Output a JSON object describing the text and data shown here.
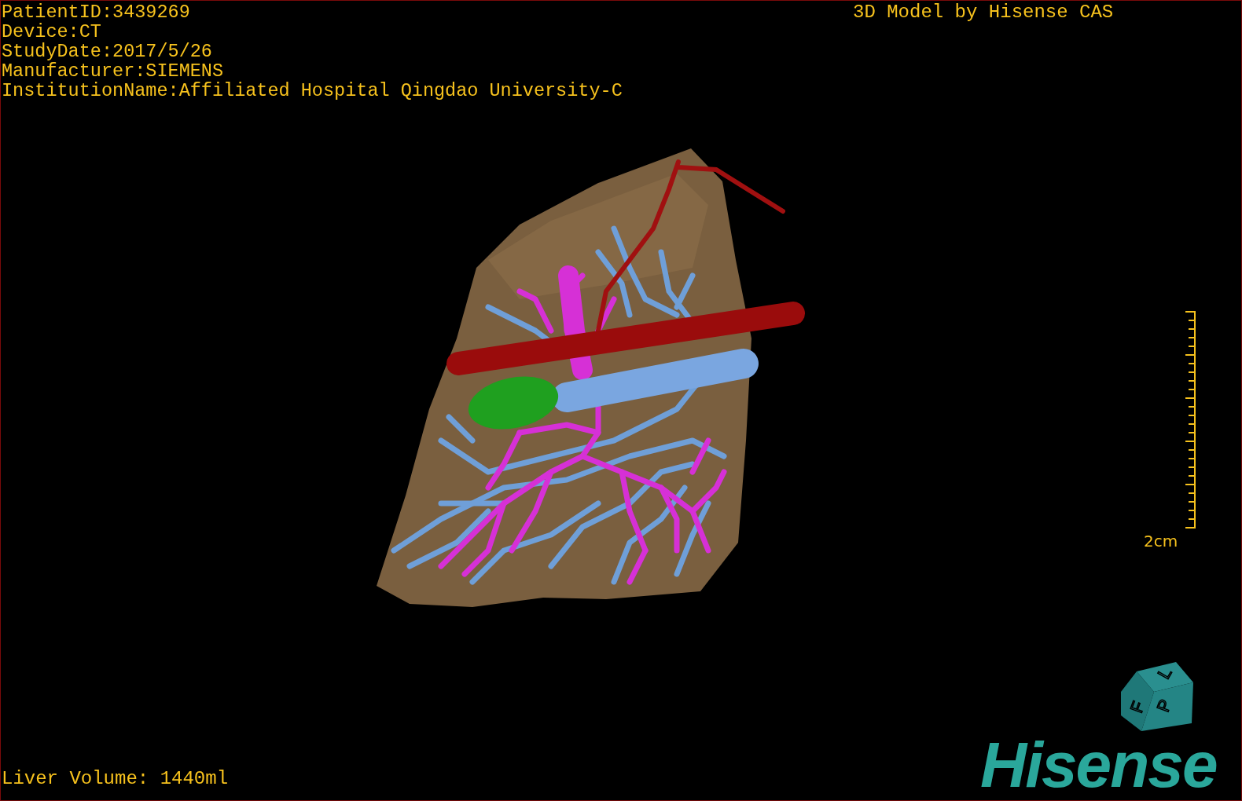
{
  "info_lines": [
    "PatientID:3439269",
    "Device:CT",
    "StudyDate:2017/5/26",
    "Manufacturer:SIEMENS",
    "InstitutionName:Affiliated Hospital Qingdao University-C"
  ],
  "title": "3D Model by Hisense CAS",
  "scale_bar": {
    "label": "2cm"
  },
  "liver_volume": "Liver Volume: 1440ml",
  "orientation_cube": {
    "faces": [
      "F",
      "L",
      "P"
    ]
  },
  "logo": "Hisense"
}
